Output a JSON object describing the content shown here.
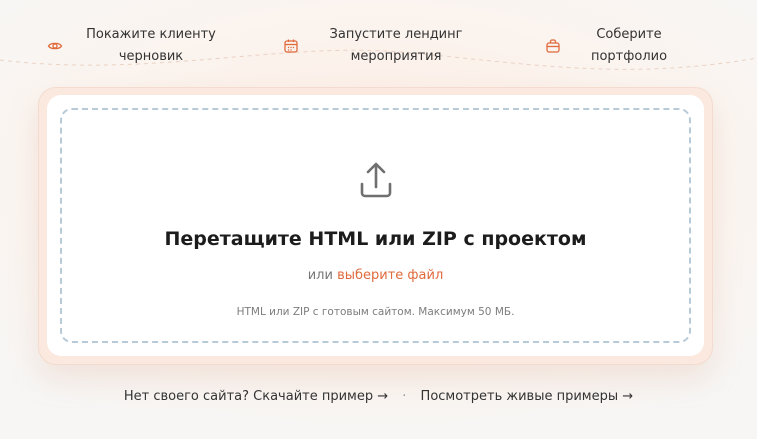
{
  "features": [
    {
      "icon": "eye-icon",
      "label": "Покажите клиенту черновик"
    },
    {
      "icon": "calendar-icon",
      "label": "Запустите лендинг мероприятия"
    },
    {
      "icon": "bag-icon",
      "label": "Соберите портфолио"
    }
  ],
  "dropzone": {
    "icon": "upload-icon",
    "title": "Перетащите HTML или ZIP с проектом",
    "or_text": "или",
    "pick_link": "выберите файл",
    "hint": "HTML или ZIP с готовым сайтом. Максимум 50 МБ."
  },
  "bottom": {
    "download_link": "Нет своего сайта? Скачайте пример →",
    "separator": "·",
    "examples_link": "Посмотреть живые примеры →"
  },
  "colors": {
    "accent": "#e06a3c",
    "dash": "#b7cad8"
  }
}
